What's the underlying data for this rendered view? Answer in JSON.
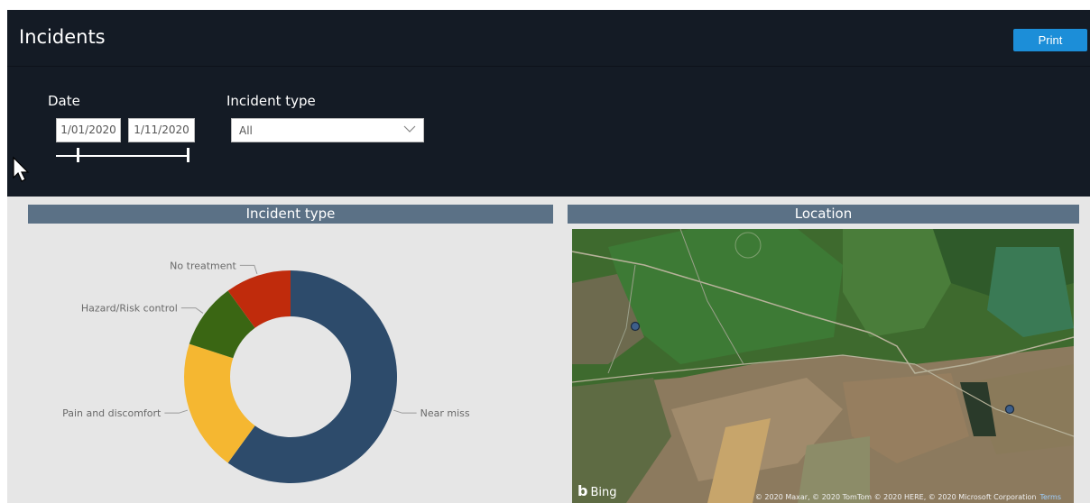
{
  "header": {
    "title": "Incidents",
    "print_label": "Print"
  },
  "filters": {
    "date_label": "Date",
    "date_start": "1/01/2020",
    "date_end": "1/11/2020",
    "incident_type_label": "Incident type",
    "incident_type_value": "All"
  },
  "panels": {
    "incident_type_title": "Incident type",
    "location_title": "Location"
  },
  "chart_data": {
    "type": "pie",
    "title": "Incident type",
    "categories": [
      "Near miss",
      "Pain and discomfort",
      "Hazard/Risk control",
      "No treatment"
    ],
    "values": [
      60,
      20,
      10,
      10
    ],
    "colors": [
      "#2d4b6b",
      "#f5b731",
      "#3a6613",
      "#c02b0c"
    ],
    "donut": true
  },
  "map": {
    "provider": "Bing",
    "attribution": "© 2020 Maxar, © 2020 TomTom © 2020 HERE, © 2020 Microsoft Corporation",
    "terms": "Terms"
  },
  "icons": {
    "dropdown": "chevron-down-icon",
    "cursor": "mouse-cursor-icon"
  }
}
